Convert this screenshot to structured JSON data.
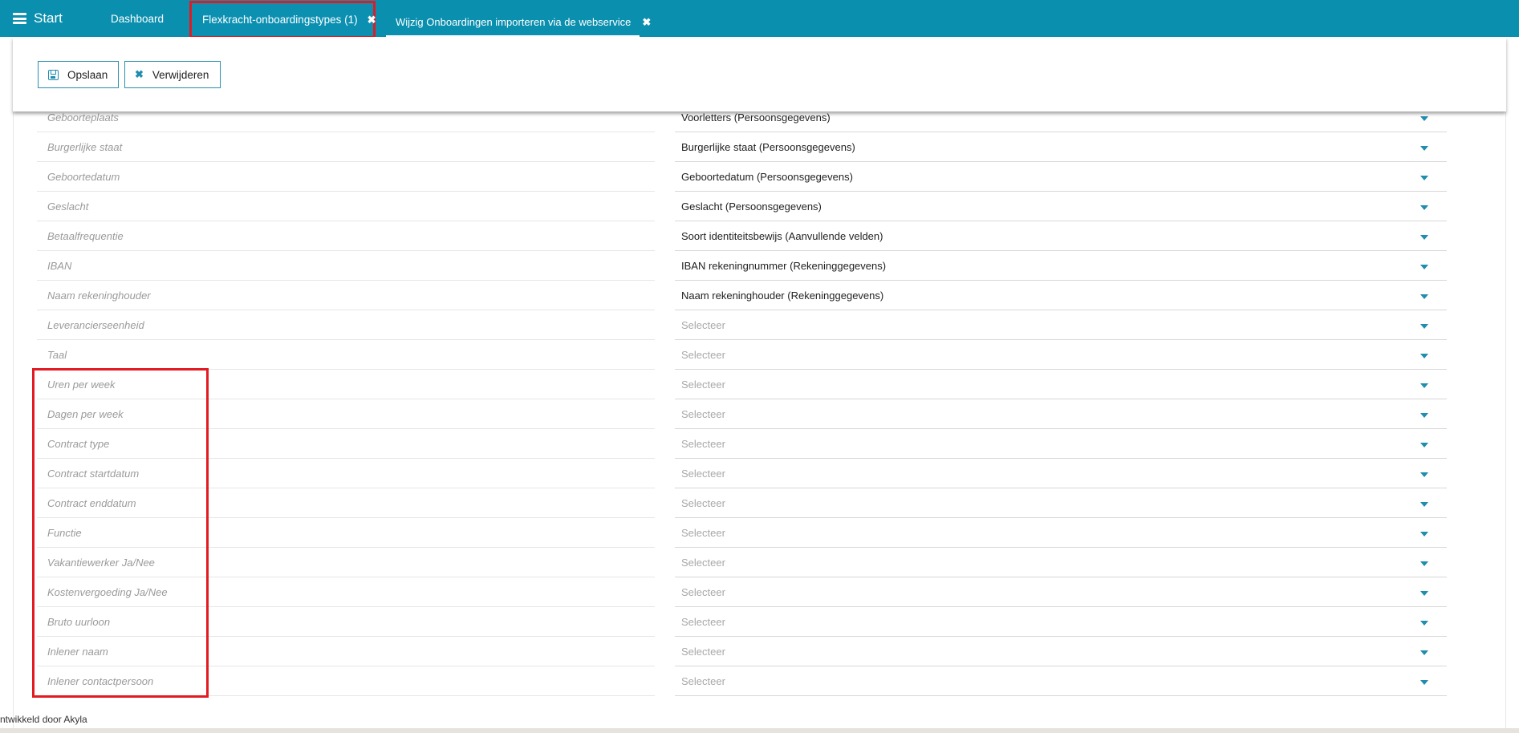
{
  "topbar": {
    "start_label": "Start",
    "tabs": [
      {
        "label": "Dashboard"
      },
      {
        "label": "Flexkracht-onboardingstypes (1)",
        "close": "✖"
      },
      {
        "label": "Wijzig Onboardingen importeren via de webservice",
        "close": "✖"
      }
    ]
  },
  "toolbar": {
    "save_label": "Opslaan",
    "delete_label": "Verwijderen"
  },
  "rows": [
    {
      "label": "Geboorteplaats",
      "value": "Voorletters (Persoonsgegevens)"
    },
    {
      "label": "Burgerlijke staat",
      "value": "Burgerlijke staat (Persoonsgegevens)"
    },
    {
      "label": "Geboortedatum",
      "value": "Geboortedatum (Persoonsgegevens)"
    },
    {
      "label": "Geslacht",
      "value": "Geslacht (Persoonsgegevens)"
    },
    {
      "label": "Betaalfrequentie",
      "value": "Soort identiteitsbewijs (Aanvullende velden)"
    },
    {
      "label": "IBAN",
      "value": "IBAN rekeningnummer (Rekeninggegevens)"
    },
    {
      "label": "Naam rekeninghouder",
      "value": "Naam rekeninghouder (Rekeninggegevens)"
    },
    {
      "label": "Leverancierseenheid",
      "value": "Selecteer",
      "placeholder": true
    },
    {
      "label": "Taal",
      "value": "Selecteer",
      "placeholder": true
    },
    {
      "label": "Uren per week",
      "value": "Selecteer",
      "placeholder": true
    },
    {
      "label": "Dagen per week",
      "value": "Selecteer",
      "placeholder": true
    },
    {
      "label": "Contract type",
      "value": "Selecteer",
      "placeholder": true
    },
    {
      "label": "Contract startdatum",
      "value": "Selecteer",
      "placeholder": true
    },
    {
      "label": "Contract enddatum",
      "value": "Selecteer",
      "placeholder": true
    },
    {
      "label": "Functie",
      "value": "Selecteer",
      "placeholder": true
    },
    {
      "label": "Vakantiewerker Ja/Nee",
      "value": "Selecteer",
      "placeholder": true
    },
    {
      "label": "Kostenvergoeding Ja/Nee",
      "value": "Selecteer",
      "placeholder": true
    },
    {
      "label": "Bruto uurloon",
      "value": "Selecteer",
      "placeholder": true
    },
    {
      "label": "Inlener naam",
      "value": "Selecteer",
      "placeholder": true
    },
    {
      "label": "Inlener contactpersoon",
      "value": "Selecteer",
      "placeholder": true
    }
  ],
  "footer": {
    "credit": "ntwikkeld door Akyla"
  },
  "colors": {
    "topbar": "#0a8fae",
    "highlight": "#e21b23",
    "accent": "#1f8cb0"
  }
}
